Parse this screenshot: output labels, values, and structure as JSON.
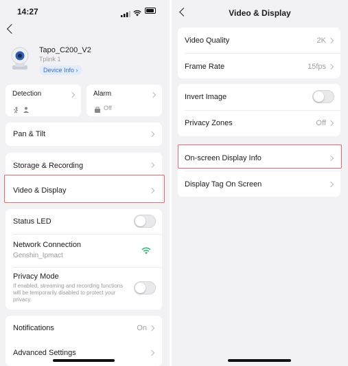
{
  "status_bar": {
    "time": "14:27"
  },
  "left": {
    "device": {
      "name": "Tapo_C200_V2",
      "model": "Tplink 1",
      "info_button": "Device Info"
    },
    "detection": {
      "label": "Detection"
    },
    "alarm": {
      "label": "Alarm",
      "value": "Off"
    },
    "pan_tilt": {
      "label": "Pan & Tilt"
    },
    "storage": {
      "label": "Storage & Recording"
    },
    "video_display": {
      "label": "Video & Display"
    },
    "status_led": {
      "label": "Status LED"
    },
    "network": {
      "label": "Network Connection",
      "ssid": "Genshin_Ipmact"
    },
    "privacy": {
      "label": "Privacy Mode",
      "description": "If enabled, streaming and recording functions will be temporarily disabled to protect your privacy."
    },
    "notifications": {
      "label": "Notifications",
      "value": "On"
    },
    "advanced": {
      "label": "Advanced Settings"
    }
  },
  "right": {
    "title": "Video & Display",
    "video_quality": {
      "label": "Video Quality",
      "value": "2K"
    },
    "frame_rate": {
      "label": "Frame Rate",
      "value": "15fps"
    },
    "invert_image": {
      "label": "Invert Image"
    },
    "privacy_zones": {
      "label": "Privacy Zones",
      "value": "Off"
    },
    "osd_info": {
      "label": "On-screen Display Info"
    },
    "display_tag": {
      "label": "Display Tag On Screen"
    }
  },
  "colors": {
    "highlight": "#e86a6a",
    "wifi": "#2bb673",
    "info_badge": "#e3ecfa"
  }
}
